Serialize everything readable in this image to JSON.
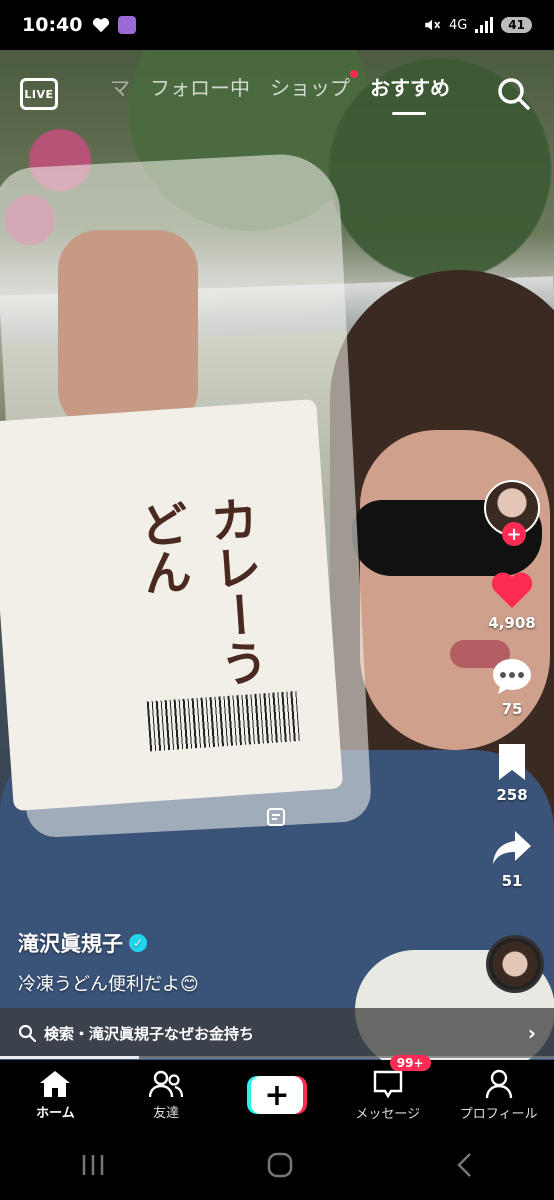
{
  "status_bar": {
    "time": "10:40",
    "network": "4G",
    "battery": "41",
    "icons": [
      "heart-icon",
      "app-badge-icon",
      "mute-icon",
      "wifi-icon",
      "signal-icon"
    ]
  },
  "top_nav": {
    "live_label": "LIVE",
    "tabs": [
      {
        "label": "マ",
        "active": false
      },
      {
        "label": "フォロー中",
        "active": false
      },
      {
        "label": "ショップ",
        "active": false,
        "dot": true
      },
      {
        "label": "おすすめ",
        "active": true
      }
    ]
  },
  "video": {
    "package_title": "カレーうどん"
  },
  "actions": {
    "likes": "4,908",
    "comments": "75",
    "saves": "258",
    "shares": "51"
  },
  "caption": {
    "author": "滝沢眞規子",
    "description": "冷凍うどん便利だよ😊"
  },
  "search_suggestion": {
    "text": "検索・滝沢眞規子なぜお金持ち"
  },
  "playback_progress": 0.25,
  "bottom_nav": {
    "items": [
      {
        "label": "ホーム",
        "active": true
      },
      {
        "label": "友達",
        "active": false
      },
      {
        "label": "",
        "active": false
      },
      {
        "label": "メッセージ",
        "active": false,
        "badge": "99+"
      },
      {
        "label": "プロフィール",
        "active": false
      }
    ]
  },
  "colors": {
    "accent_red": "#fe2c55",
    "accent_cyan": "#25f4ee",
    "verified": "#20d5ec"
  }
}
